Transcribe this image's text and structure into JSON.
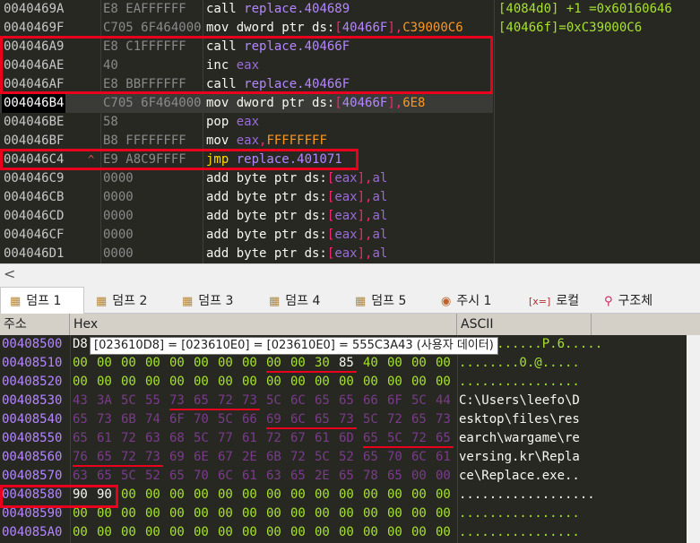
{
  "disasm": {
    "rows": [
      {
        "addr": "0040469A",
        "bytes": "E8 EAFFFFFF",
        "tokens": [
          [
            "call ",
            "t-plain"
          ],
          [
            "replace.404689",
            "t-tgt"
          ]
        ]
      },
      {
        "addr": "0040469F",
        "bytes": "C705 6F464000",
        "tokens": [
          [
            "mov ",
            "t-plain"
          ],
          [
            "dword ptr ",
            "t-kw"
          ],
          [
            "ds:",
            "t-kw"
          ],
          [
            "[",
            "t-br"
          ],
          [
            "40466F",
            "t-tgt"
          ],
          [
            "],",
            "t-br"
          ],
          [
            "C39000C6",
            "t-num"
          ]
        ]
      },
      {
        "addr": "004046A9",
        "bytes": "E8 C1FFFFFF",
        "tokens": [
          [
            "call ",
            "t-plain"
          ],
          [
            "replace.40466F",
            "t-tgt"
          ]
        ]
      },
      {
        "addr": "004046AE",
        "bytes": "40",
        "tokens": [
          [
            "inc ",
            "t-plain"
          ],
          [
            "eax",
            "t-reg"
          ]
        ]
      },
      {
        "addr": "004046AF",
        "bytes": "E8 BBFFFFFF",
        "tokens": [
          [
            "call ",
            "t-plain"
          ],
          [
            "replace.40466F",
            "t-tgt"
          ]
        ]
      },
      {
        "addr": "004046B4",
        "bytes": "C705 6F464000",
        "tokens": [
          [
            "mov ",
            "t-plain"
          ],
          [
            "dword ptr ",
            "t-kw"
          ],
          [
            "ds:",
            "t-kw"
          ],
          [
            "[",
            "t-br"
          ],
          [
            "40466F",
            "t-tgt"
          ],
          [
            "],",
            "t-br"
          ],
          [
            "6E8",
            "t-num"
          ]
        ]
      },
      {
        "addr": "004046BE",
        "bytes": "58",
        "tokens": [
          [
            "pop ",
            "t-plain"
          ],
          [
            "eax",
            "t-reg"
          ]
        ]
      },
      {
        "addr": "004046BF",
        "bytes": "B8 FFFFFFFF",
        "tokens": [
          [
            "mov ",
            "t-plain"
          ],
          [
            "eax",
            "t-reg"
          ],
          [
            ",",
            "t-br"
          ],
          [
            "FFFFFFFF",
            "t-num"
          ]
        ]
      },
      {
        "addr": "004046C4",
        "bytes": "E9 A8C9FFFF",
        "arrow": "^",
        "tokens": [
          [
            "jmp ",
            "t-jmp"
          ],
          [
            "replace.401071",
            "t-tgt"
          ]
        ]
      },
      {
        "addr": "004046C9",
        "bytes": "0000",
        "tokens": [
          [
            "add ",
            "t-plain"
          ],
          [
            "byte ptr ",
            "t-kw"
          ],
          [
            "ds:",
            "t-kw"
          ],
          [
            "[",
            "t-br"
          ],
          [
            "eax",
            "t-reg"
          ],
          [
            "],",
            "t-br"
          ],
          [
            "al",
            "t-reg"
          ]
        ]
      },
      {
        "addr": "004046CB",
        "bytes": "0000",
        "tokens": [
          [
            "add ",
            "t-plain"
          ],
          [
            "byte ptr ",
            "t-kw"
          ],
          [
            "ds:",
            "t-kw"
          ],
          [
            "[",
            "t-br"
          ],
          [
            "eax",
            "t-reg"
          ],
          [
            "],",
            "t-br"
          ],
          [
            "al",
            "t-reg"
          ]
        ]
      },
      {
        "addr": "004046CD",
        "bytes": "0000",
        "tokens": [
          [
            "add ",
            "t-plain"
          ],
          [
            "byte ptr ",
            "t-kw"
          ],
          [
            "ds:",
            "t-kw"
          ],
          [
            "[",
            "t-br"
          ],
          [
            "eax",
            "t-reg"
          ],
          [
            "],",
            "t-br"
          ],
          [
            "al",
            "t-reg"
          ]
        ]
      },
      {
        "addr": "004046CF",
        "bytes": "0000",
        "tokens": [
          [
            "add ",
            "t-plain"
          ],
          [
            "byte ptr ",
            "t-kw"
          ],
          [
            "ds:",
            "t-kw"
          ],
          [
            "[",
            "t-br"
          ],
          [
            "eax",
            "t-reg"
          ],
          [
            "],",
            "t-br"
          ],
          [
            "al",
            "t-reg"
          ]
        ]
      },
      {
        "addr": "004046D1",
        "bytes": "0000",
        "tokens": [
          [
            "add ",
            "t-plain"
          ],
          [
            "byte ptr ",
            "t-kw"
          ],
          [
            "ds:",
            "t-kw"
          ],
          [
            "[",
            "t-br"
          ],
          [
            "eax",
            "t-reg"
          ],
          [
            "],",
            "t-br"
          ],
          [
            "al",
            "t-reg"
          ]
        ]
      }
    ],
    "selected_index": 5,
    "comments": [
      {
        "row": 0,
        "text": "[4084d0] +1 =0x60160646"
      },
      {
        "row": 1,
        "text": "[40466f]=0xC39000C6"
      }
    ]
  },
  "scroll_left_glyph": "<",
  "tabs": [
    {
      "label": "덤프 1",
      "icon": "dump",
      "glyph": "▦",
      "active": true
    },
    {
      "label": "덤프 2",
      "icon": "dump",
      "glyph": "▦"
    },
    {
      "label": "덤프 3",
      "icon": "dump",
      "glyph": "▦"
    },
    {
      "label": "덤프 4",
      "icon": "dump",
      "glyph": "▦"
    },
    {
      "label": "덤프 5",
      "icon": "dump",
      "glyph": "▦"
    },
    {
      "label": "주시 1",
      "icon": "watch",
      "glyph": "◉"
    },
    {
      "label": "로컬",
      "icon": "local",
      "glyph": "[x=]"
    },
    {
      "label": "구조체",
      "icon": "struct",
      "glyph": "⚲"
    }
  ],
  "dump": {
    "headers": {
      "addr": "주소",
      "hex": "Hex",
      "ascii": "ASCII"
    },
    "rows": [
      {
        "addr": "00408500",
        "bytes": [
          "D8",
          "",
          "",
          "",
          "",
          "",
          "",
          "",
          "",
          "",
          "",
          "",
          "",
          "",
          "",
          ""
        ],
        "ascii": "...........P.6....."
      },
      {
        "addr": "00408510",
        "bytes": [
          "00",
          "00",
          "00",
          "00",
          "00",
          "00",
          "00",
          "00",
          "00",
          "00",
          "30",
          "85",
          "40",
          "00",
          "00",
          "00"
        ],
        "ascii": "........0.@....."
      },
      {
        "addr": "00408520",
        "bytes": [
          "00",
          "00",
          "00",
          "00",
          "00",
          "00",
          "00",
          "00",
          "00",
          "00",
          "00",
          "00",
          "00",
          "00",
          "00",
          "00"
        ],
        "ascii": "................"
      },
      {
        "addr": "00408530",
        "bytes": [
          "43",
          "3A",
          "5C",
          "55",
          "73",
          "65",
          "72",
          "73",
          "5C",
          "6C",
          "65",
          "65",
          "66",
          "6F",
          "5C",
          "44"
        ],
        "ascii": "C:\\Users\\leefo\\D"
      },
      {
        "addr": "00408540",
        "bytes": [
          "65",
          "73",
          "6B",
          "74",
          "6F",
          "70",
          "5C",
          "66",
          "69",
          "6C",
          "65",
          "73",
          "5C",
          "72",
          "65",
          "73"
        ],
        "ascii": "esktop\\files\\res"
      },
      {
        "addr": "00408550",
        "bytes": [
          "65",
          "61",
          "72",
          "63",
          "68",
          "5C",
          "77",
          "61",
          "72",
          "67",
          "61",
          "6D",
          "65",
          "5C",
          "72",
          "65"
        ],
        "ascii": "earch\\wargame\\re"
      },
      {
        "addr": "00408560",
        "bytes": [
          "76",
          "65",
          "72",
          "73",
          "69",
          "6E",
          "67",
          "2E",
          "6B",
          "72",
          "5C",
          "52",
          "65",
          "70",
          "6C",
          "61"
        ],
        "ascii": "versing.kr\\Repla"
      },
      {
        "addr": "00408570",
        "bytes": [
          "63",
          "65",
          "5C",
          "52",
          "65",
          "70",
          "6C",
          "61",
          "63",
          "65",
          "2E",
          "65",
          "78",
          "65",
          "00",
          "00"
        ],
        "ascii": "ce\\Replace.exe.."
      },
      {
        "addr": "00408580",
        "bytes": [
          "90",
          "90",
          "00",
          "00",
          "00",
          "00",
          "00",
          "00",
          "00",
          "00",
          "00",
          "00",
          "00",
          "00",
          "00",
          "00"
        ],
        "ascii": ".................."
      },
      {
        "addr": "00408590",
        "bytes": [
          "00",
          "00",
          "00",
          "00",
          "00",
          "00",
          "00",
          "00",
          "00",
          "00",
          "00",
          "00",
          "00",
          "00",
          "00",
          "00"
        ],
        "ascii": "................"
      },
      {
        "addr": "004085A0",
        "bytes": [
          "00",
          "00",
          "00",
          "00",
          "00",
          "00",
          "00",
          "00",
          "00",
          "00",
          "00",
          "00",
          "00",
          "00",
          "00",
          "00"
        ],
        "ascii": "................"
      }
    ]
  },
  "tooltip": "[023610D8] = [023610E0] = [023610E0] = 555C3A43 (사용자 데이터)"
}
